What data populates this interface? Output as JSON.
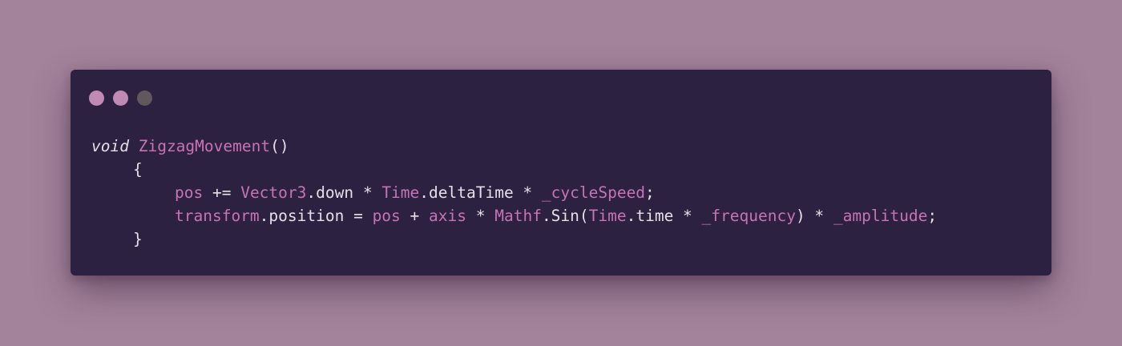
{
  "window": {
    "controls": [
      {
        "name": "close",
        "color": "#c08ab4"
      },
      {
        "name": "minimize",
        "color": "#c08ab4"
      },
      {
        "name": "maximize",
        "color": "#61575f"
      }
    ]
  },
  "colors": {
    "background": "#a3839b",
    "panel": "#2c2140",
    "text": "#e6dfe8",
    "accent": "#c773b6"
  },
  "code": {
    "lines": [
      {
        "indent": 0,
        "tokens": [
          {
            "text": "void",
            "kind": "keyword"
          },
          {
            "text": " ",
            "kind": "plain"
          },
          {
            "text": "ZigzagMovement",
            "kind": "accent"
          },
          {
            "text": "()",
            "kind": "plain"
          }
        ]
      },
      {
        "indent": 1,
        "tokens": [
          {
            "text": "{",
            "kind": "plain"
          }
        ]
      },
      {
        "indent": 2,
        "tokens": [
          {
            "text": "pos",
            "kind": "accent"
          },
          {
            "text": " += ",
            "kind": "plain"
          },
          {
            "text": "Vector3",
            "kind": "accent"
          },
          {
            "text": ".down * ",
            "kind": "plain"
          },
          {
            "text": "Time",
            "kind": "accent"
          },
          {
            "text": ".deltaTime * ",
            "kind": "plain"
          },
          {
            "text": "_cycleSpeed",
            "kind": "accent"
          },
          {
            "text": ";",
            "kind": "plain"
          }
        ]
      },
      {
        "indent": 2,
        "tokens": [
          {
            "text": "transform",
            "kind": "accent"
          },
          {
            "text": ".position = ",
            "kind": "plain"
          },
          {
            "text": "pos",
            "kind": "accent"
          },
          {
            "text": " + ",
            "kind": "plain"
          },
          {
            "text": "axis",
            "kind": "accent"
          },
          {
            "text": " * ",
            "kind": "plain"
          },
          {
            "text": "Mathf",
            "kind": "accent"
          },
          {
            "text": ".Sin(",
            "kind": "plain"
          },
          {
            "text": "Time",
            "kind": "accent"
          },
          {
            "text": ".time * ",
            "kind": "plain"
          },
          {
            "text": "_frequency",
            "kind": "accent"
          },
          {
            "text": ") * ",
            "kind": "plain"
          },
          {
            "text": "_amplitude",
            "kind": "accent"
          },
          {
            "text": ";",
            "kind": "plain"
          }
        ]
      },
      {
        "indent": 1,
        "tokens": [
          {
            "text": "}",
            "kind": "plain"
          }
        ]
      }
    ]
  }
}
